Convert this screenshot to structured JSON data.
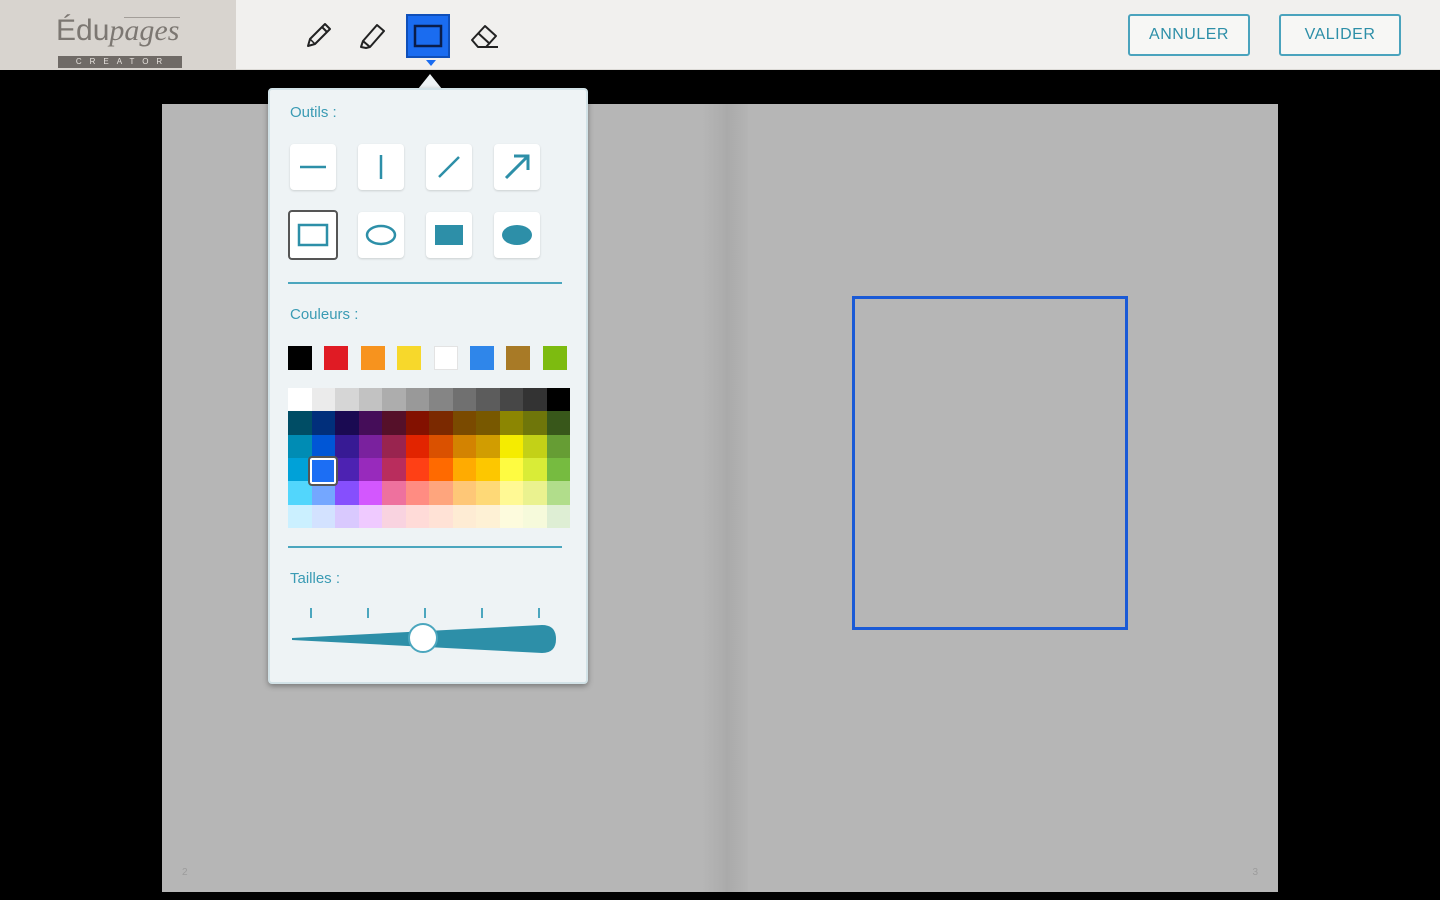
{
  "logo": {
    "word_main": "Édu",
    "word_italic": "pages",
    "subtitle": "CREATOR"
  },
  "toolbar": {
    "tools": [
      {
        "name": "pencil",
        "icon": "pencil-icon"
      },
      {
        "name": "highlighter",
        "icon": "highlighter-icon"
      },
      {
        "name": "shape",
        "icon": "rectangle-icon",
        "active": true
      },
      {
        "name": "eraser",
        "icon": "eraser-icon"
      }
    ],
    "cancel_label": "ANNULER",
    "validate_label": "VALIDER"
  },
  "popup": {
    "tools_label": "Outils :",
    "shapes": [
      "horizontal-line",
      "vertical-line",
      "diagonal-line",
      "arrow",
      "rectangle-outline",
      "ellipse-outline",
      "rectangle-filled",
      "ellipse-filled"
    ],
    "selected_shape": "rectangle-outline",
    "colors_label": "Couleurs :",
    "quick_colors": [
      "#000000",
      "#e01b24",
      "#f7931e",
      "#f7d82b",
      "#ffffff",
      "#2f86ea",
      "#a87a26",
      "#7dbb10"
    ],
    "selected_color": "#1c6ef4",
    "sizes_label": "Tailles :",
    "size_level": 0.5
  },
  "book": {
    "left_page_number": "2",
    "right_page_number": "3"
  },
  "colors": {
    "accent": "#4ba6be",
    "active_tool": "#1a6cf0",
    "drawn_rect": "#1a5ad6"
  }
}
